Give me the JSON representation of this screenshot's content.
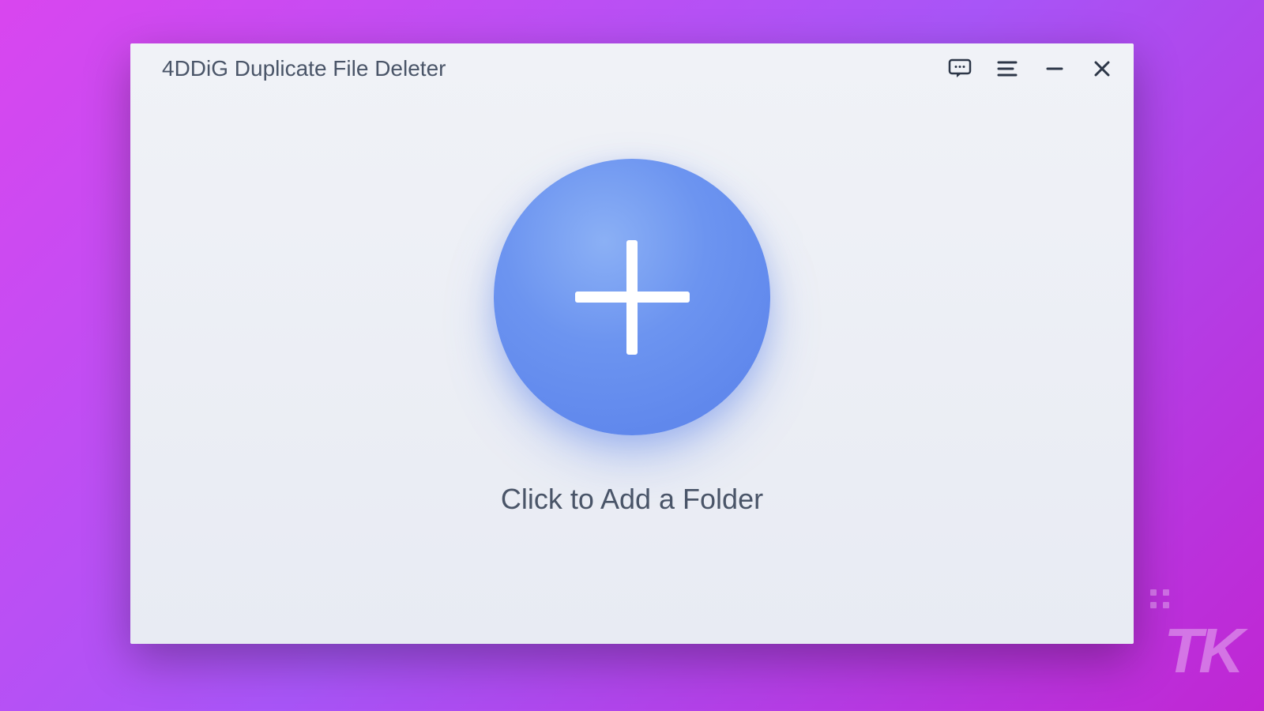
{
  "app": {
    "title": "4DDiG Duplicate File Deleter"
  },
  "main": {
    "add_folder_label": "Click to Add a Folder"
  },
  "watermark": {
    "text": "TK"
  }
}
